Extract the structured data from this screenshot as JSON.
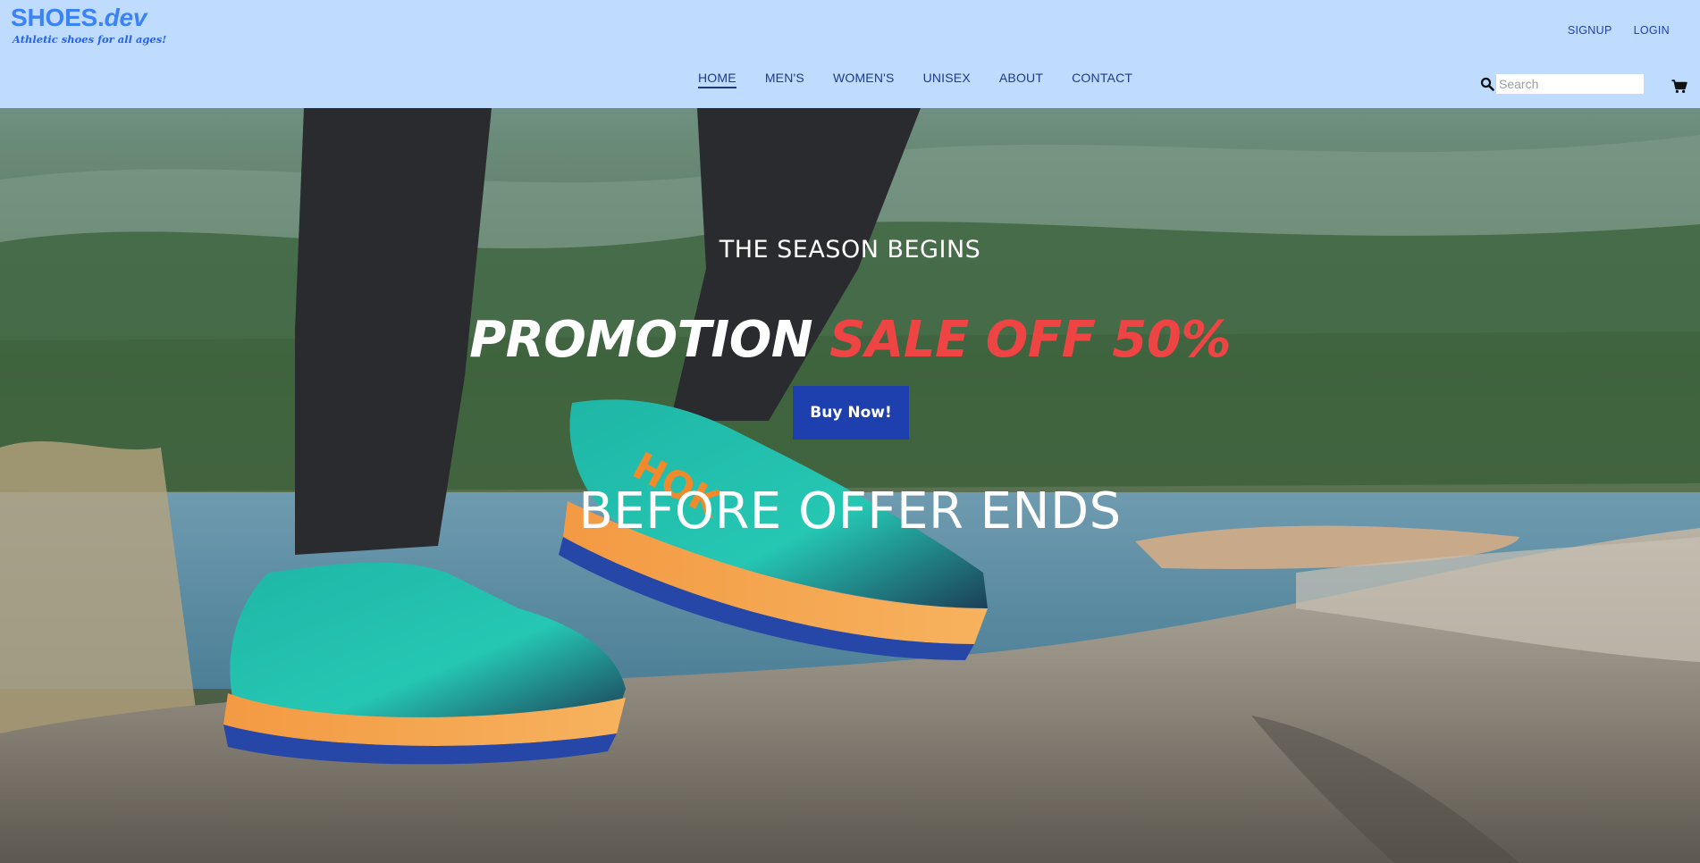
{
  "brand": {
    "name": "SHOES.",
    "tld": "dev",
    "tagline": "Athletic shoes for all ages!"
  },
  "auth": {
    "signup_label": "SIGNUP",
    "login_label": "LOGIN"
  },
  "nav": {
    "items": [
      {
        "label": "HOME",
        "active": true
      },
      {
        "label": "MEN'S",
        "active": false
      },
      {
        "label": "WOMEN'S",
        "active": false
      },
      {
        "label": "UNISEX",
        "active": false
      },
      {
        "label": "ABOUT",
        "active": false
      },
      {
        "label": "CONTACT",
        "active": false
      }
    ]
  },
  "search": {
    "placeholder": "Search",
    "value": ""
  },
  "icons": {
    "search": "search-icon",
    "cart": "cart-icon"
  },
  "hero": {
    "eyebrow": "THE SEASON BEGINS",
    "headline_white": "PROMOTION",
    "headline_accent": "SALE OFF 50%",
    "cta_label": "Buy Now!",
    "footer_text": "BEFORE OFFER ENDS"
  },
  "colors": {
    "header_bg": "#bfdbfe",
    "brand": "#3b82f6",
    "nav_text": "#1e3a8a",
    "accent_red": "#ef4444",
    "cta_bg": "#1e40af"
  }
}
